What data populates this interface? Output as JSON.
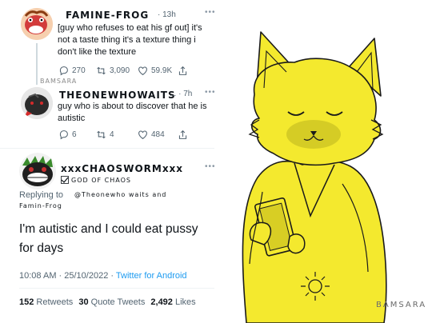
{
  "tweet1": {
    "author": "FAMINE-FROG",
    "time": "· 13h",
    "text_line1": "[guy who refuses to eat his gf out] it's",
    "text_line2": "not a taste thing it's a texture thing i",
    "text_line3": "don't like the texture",
    "replies": "270",
    "retweets": "3,090",
    "likes": "59.9K"
  },
  "watermark_top": "BAMSARA",
  "tweet2": {
    "author": "THEONEWHOWAITS",
    "time": "... · 7h",
    "text_line1": "guy who is about to discover that he is",
    "text_line2": "autistic",
    "replies": "6",
    "retweets": "4",
    "likes": "484"
  },
  "tweet3": {
    "author": "xxxCHAOSWORMxxx",
    "subtitle": "GOD OF CHAOS",
    "replying_prefix": "Replying to",
    "replying_handwritten_1": "@Theonewho waits and",
    "replying_handwritten_2": "Famin-Frog",
    "text_line1": "I'm autistic and I could eat pussy",
    "text_line2": "for days",
    "timestamp": "10:08 AM · 25/10/2022 · ",
    "client": "Twitter for Android",
    "retweets_count": "152",
    "retweets_label": "Retweets",
    "quotes_count": "30",
    "quotes_label": "Quote Tweets",
    "likes_count": "2,492",
    "likes_label": "Likes"
  },
  "signature": "BAMSARA",
  "colors": {
    "drawing_yellow": "#f4e92e",
    "link_blue": "#1d9bf0",
    "muted_gray": "#536471"
  }
}
